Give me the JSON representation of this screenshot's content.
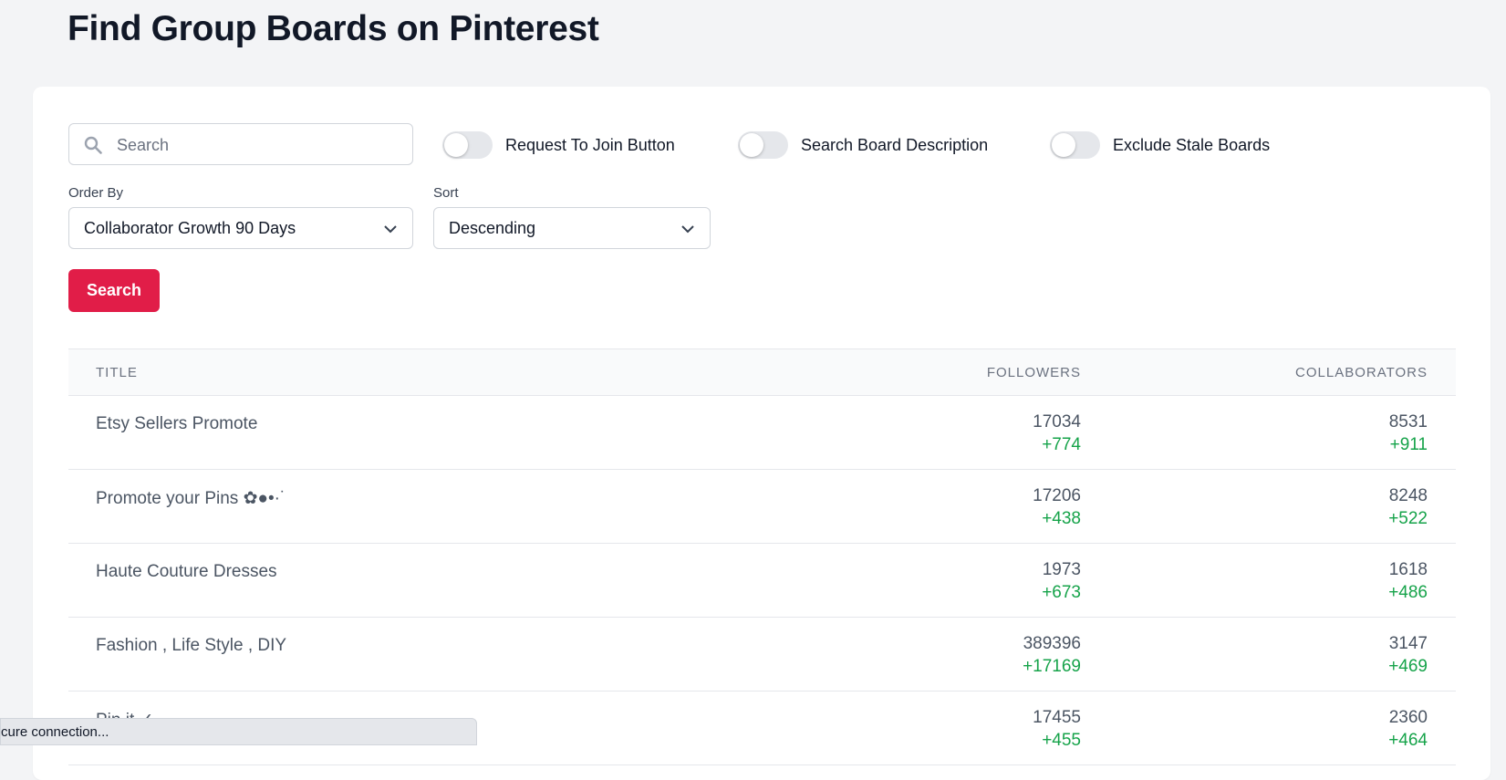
{
  "page": {
    "title": "Find Group Boards on Pinterest"
  },
  "filters": {
    "search_placeholder": "Search",
    "search_value": "",
    "toggles": [
      {
        "label": "Request To Join Button",
        "on": false
      },
      {
        "label": "Search Board Description",
        "on": false
      },
      {
        "label": "Exclude Stale Boards",
        "on": false
      }
    ],
    "order_by": {
      "label": "Order By",
      "value": "Collaborator Growth 90 Days"
    },
    "sort": {
      "label": "Sort",
      "value": "Descending"
    },
    "search_button": "Search"
  },
  "table": {
    "headers": {
      "title": "TITLE",
      "followers": "FOLLOWERS",
      "collaborators": "COLLABORATORS"
    },
    "rows": [
      {
        "title": "Etsy Sellers Promote",
        "followers": "17034",
        "followers_delta": "+774",
        "collaborators": "8531",
        "collaborators_delta": "+911"
      },
      {
        "title": "Promote your Pins ✿●•·˙",
        "followers": "17206",
        "followers_delta": "+438",
        "collaborators": "8248",
        "collaborators_delta": "+522"
      },
      {
        "title": "Haute Couture Dresses",
        "followers": "1973",
        "followers_delta": "+673",
        "collaborators": "1618",
        "collaborators_delta": "+486"
      },
      {
        "title": "Fashion , Life Style , DIY",
        "followers": "389396",
        "followers_delta": "+17169",
        "collaborators": "3147",
        "collaborators_delta": "+469"
      },
      {
        "title": "Pin it ✓",
        "followers": "17455",
        "followers_delta": "+455",
        "collaborators": "2360",
        "collaborators_delta": "+464"
      }
    ]
  },
  "status_bar": {
    "text": "cure connection..."
  },
  "colors": {
    "accent": "#e11d48",
    "positive": "#16a34a"
  }
}
